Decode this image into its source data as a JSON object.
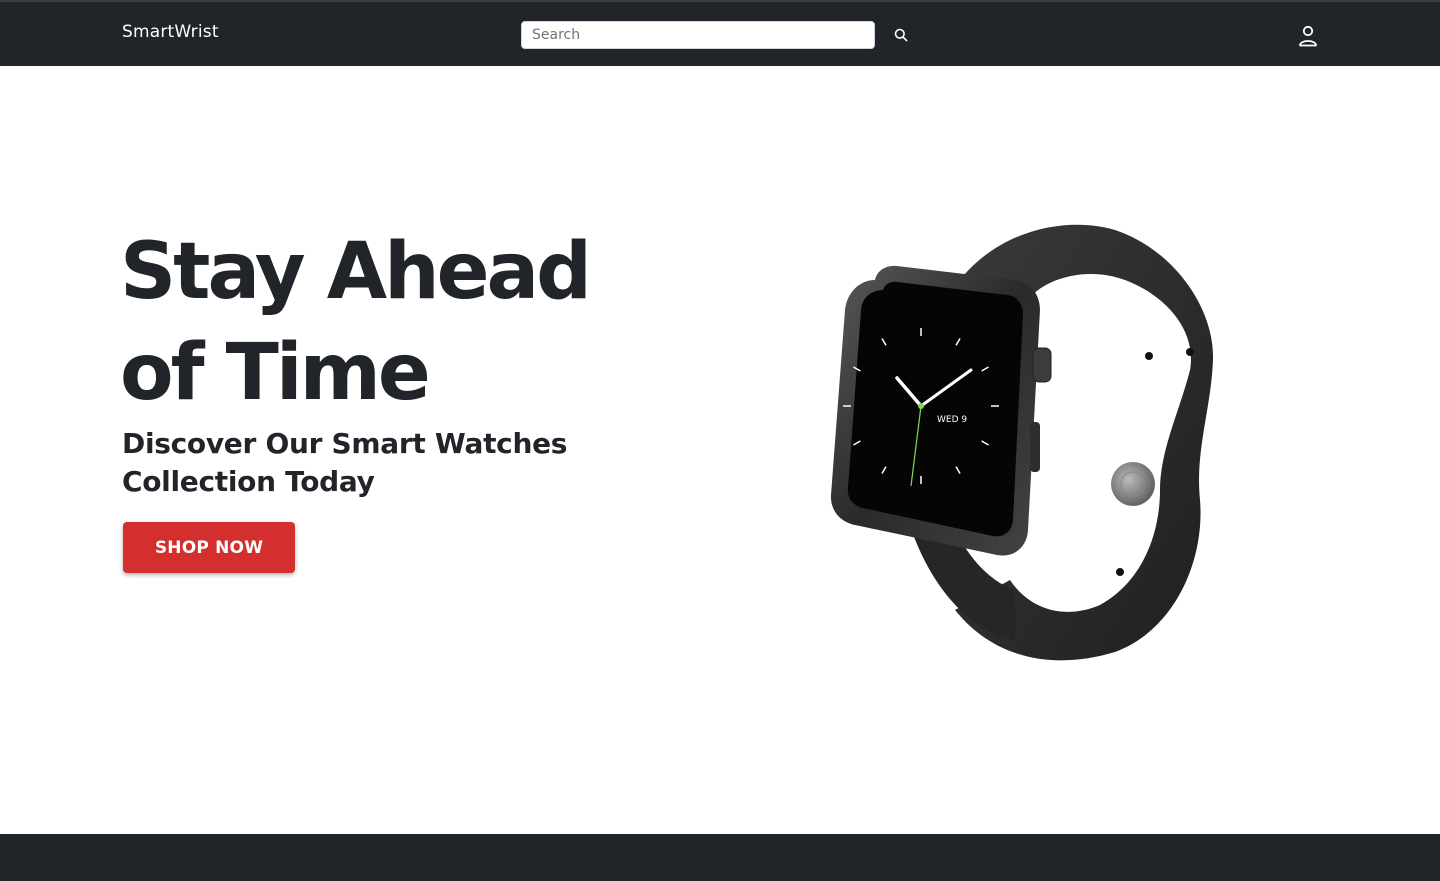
{
  "header": {
    "brand": "SmartWrist",
    "search_placeholder": "Search",
    "search_value": "",
    "icons": {
      "search": "search-icon",
      "user": "user-icon"
    }
  },
  "hero": {
    "title_line1": "Stay Ahead",
    "title_line2": "of Time",
    "subtitle_line1": "Discover Our Smart Watches",
    "subtitle_line2": "Collection Today",
    "cta_label": "SHOP NOW",
    "watch_date_label": "WED 9"
  },
  "colors": {
    "header_bg": "#212529",
    "cta_bg": "#d32f2f",
    "text_primary": "#212529",
    "footer_bg": "#212529"
  }
}
